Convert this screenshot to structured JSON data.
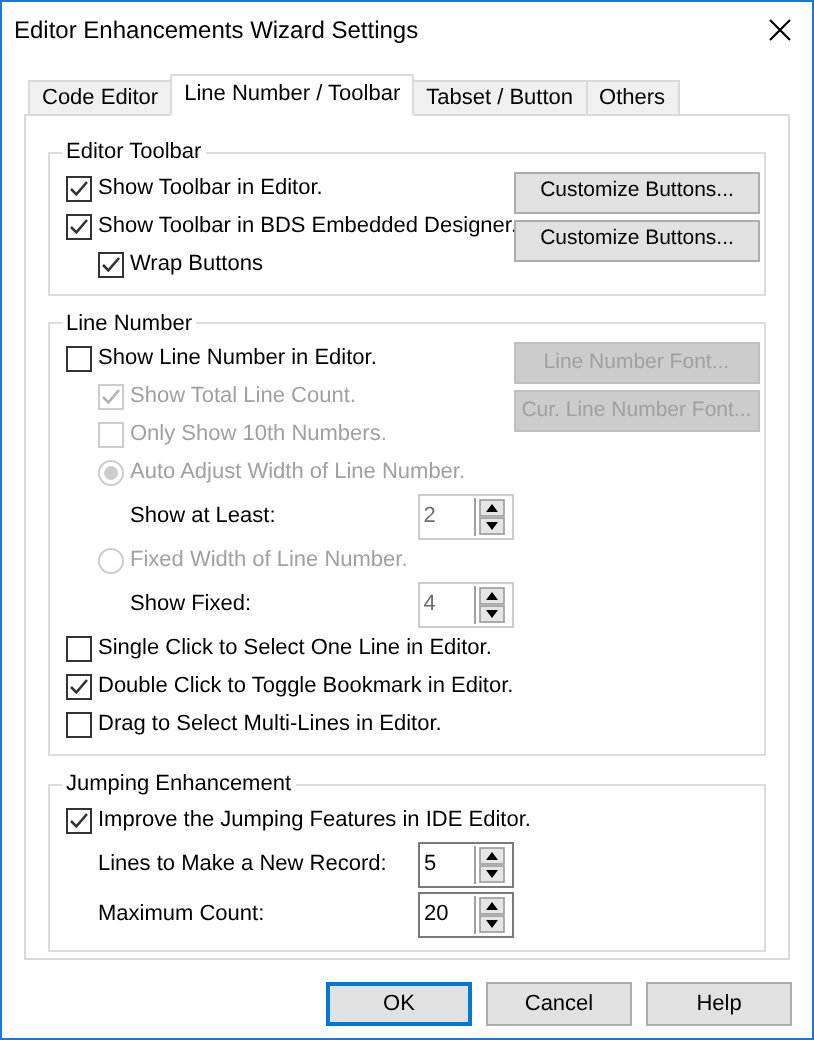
{
  "window": {
    "title": "Editor Enhancements Wizard Settings"
  },
  "tabs": [
    {
      "label": "Code Editor",
      "selected": false
    },
    {
      "label": "Line Number / Toolbar",
      "selected": true
    },
    {
      "label": "Tabset / Button",
      "selected": false
    },
    {
      "label": "Others",
      "selected": false
    }
  ],
  "groups": [
    {
      "title": "Editor Toolbar",
      "buttons": [
        {
          "label": "Customize Buttons...",
          "disabled": false
        },
        {
          "label": "Customize Buttons...",
          "disabled": false
        }
      ],
      "rows": [
        {
          "kind": "checkbox",
          "label": "Show Toolbar in Editor.",
          "checked": true,
          "disabled": false
        },
        {
          "kind": "checkbox",
          "label": "Show Toolbar in BDS Embedded Designer.",
          "checked": true,
          "disabled": false,
          "children": [
            {
              "kind": "checkbox",
              "label": "Wrap Buttons",
              "checked": true,
              "disabled": false
            }
          ]
        }
      ]
    },
    {
      "title": "Line Number",
      "buttons": [
        {
          "label": "Line Number Font...",
          "disabled": true
        },
        {
          "label": "Cur. Line Number Font...",
          "disabled": true
        }
      ],
      "rows": [
        {
          "kind": "checkbox",
          "label": "Show Line Number in Editor.",
          "checked": false,
          "disabled": false,
          "children": [
            {
              "kind": "checkbox",
              "label": "Show Total Line Count.",
              "checked": true,
              "disabled": true
            },
            {
              "kind": "checkbox",
              "label": "Only Show 10th Numbers.",
              "checked": false,
              "disabled": true
            },
            {
              "kind": "radio",
              "label": "Auto Adjust Width of Line Number.",
              "selected": true,
              "disabled": true,
              "children": [
                {
                  "kind": "spin",
                  "label": "Show at Least:",
                  "value": "2",
                  "disabled": true
                }
              ]
            },
            {
              "kind": "radio",
              "label": "Fixed Width of Line Number.",
              "selected": false,
              "disabled": true,
              "children": [
                {
                  "kind": "spin",
                  "label": "Show Fixed:",
                  "value": "4",
                  "disabled": true
                }
              ]
            }
          ]
        },
        {
          "kind": "checkbox",
          "label": "Single Click to Select One Line in Editor.",
          "checked": false,
          "disabled": false
        },
        {
          "kind": "checkbox",
          "label": "Double Click to Toggle Bookmark in Editor.",
          "checked": true,
          "disabled": false
        },
        {
          "kind": "checkbox",
          "label": "Drag to Select Multi-Lines in Editor.",
          "checked": false,
          "disabled": false
        }
      ]
    },
    {
      "title": "Jumping Enhancement",
      "rows": [
        {
          "kind": "checkbox",
          "label": "Improve the Jumping Features in IDE Editor.",
          "checked": true,
          "disabled": false,
          "children": [
            {
              "kind": "spin",
              "label": "Lines to Make a New Record:",
              "value": "5",
              "disabled": false
            },
            {
              "kind": "spin",
              "label": "Maximum Count:",
              "value": "20",
              "disabled": false
            }
          ]
        }
      ]
    }
  ],
  "footer_buttons": [
    {
      "label": "OK",
      "default": true
    },
    {
      "label": "Cancel",
      "default": false
    },
    {
      "label": "Help",
      "default": false
    }
  ]
}
